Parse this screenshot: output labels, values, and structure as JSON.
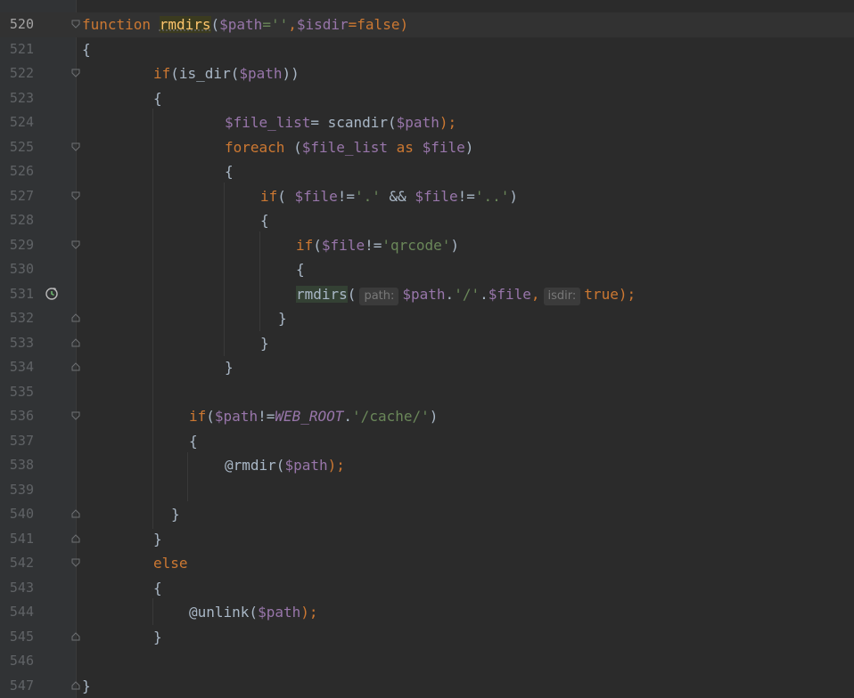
{
  "editor": {
    "lines": [
      {
        "num": "520",
        "current": true
      },
      {
        "num": "521"
      },
      {
        "num": "522"
      },
      {
        "num": "523"
      },
      {
        "num": "524"
      },
      {
        "num": "525"
      },
      {
        "num": "526"
      },
      {
        "num": "527"
      },
      {
        "num": "528"
      },
      {
        "num": "529"
      },
      {
        "num": "530"
      },
      {
        "num": "531"
      },
      {
        "num": "532"
      },
      {
        "num": "533"
      },
      {
        "num": "534"
      },
      {
        "num": "535"
      },
      {
        "num": "536"
      },
      {
        "num": "537"
      },
      {
        "num": "538"
      },
      {
        "num": "539"
      },
      {
        "num": "540"
      },
      {
        "num": "541"
      },
      {
        "num": "542"
      },
      {
        "num": "543"
      },
      {
        "num": "544"
      },
      {
        "num": "545"
      },
      {
        "num": "546"
      },
      {
        "num": "547"
      }
    ],
    "tokens": {
      "function_kw": "function",
      "fn_name": "rmdirs",
      "params_open": "(",
      "param_path": "$path",
      "eq_empty": "=''",
      "comma": ",",
      "param_isdir": "$isdir",
      "eq_false": "=false)",
      "brace_open": "{",
      "brace_close": "}",
      "if_kw": "if",
      "is_dir_call": "(is_dir(",
      "close_paren2": "))",
      "file_list_var": "$file_list",
      "assign_scandir": "= scandir(",
      "close_semi": ");",
      "foreach_kw": "foreach",
      "foreach_open": " (",
      "as_kw": "as",
      "file_var": "$file",
      "close_paren": ")",
      "if_open": "( ",
      "neq": "!=",
      "dot_str": "'.'",
      "and_op": " && ",
      "dotdot_str": "'..'",
      "if_open2": "(",
      "qrcode_str": "'qrcode'",
      "rmdirs_call": "rmdirs",
      "hint_path": "path:",
      "slash_str": "'/'",
      "dot": ".",
      "hint_isdir": "isdir:",
      "true_kw": "true",
      "neq2": "!=",
      "web_root": "WEB_ROOT",
      "cache_str": "'/cache/'",
      "rmdir_call": "@rmdir(",
      "else_kw": "else",
      "unlink_call": "@unlink(",
      "semi": ";"
    }
  }
}
